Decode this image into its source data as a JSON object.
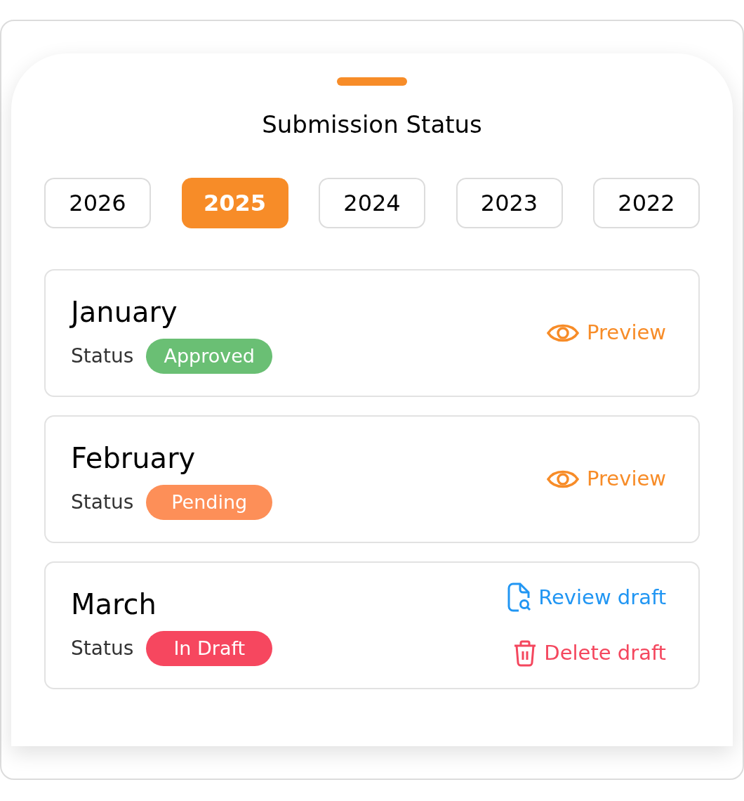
{
  "title": "Submission Status",
  "years": [
    {
      "label": "2026",
      "selected": false
    },
    {
      "label": "2025",
      "selected": true
    },
    {
      "label": "2024",
      "selected": false
    },
    {
      "label": "2023",
      "selected": false
    },
    {
      "label": "2022",
      "selected": false
    }
  ],
  "months": [
    {
      "month": "January",
      "status_label": "Status",
      "status": {
        "label": "Approved",
        "color": "#6abf74"
      },
      "actions": [
        {
          "kind": "preview",
          "label": "Preview"
        }
      ]
    },
    {
      "month": "February",
      "status_label": "Status",
      "status": {
        "label": "Pending",
        "color": "#fd8f58"
      },
      "actions": [
        {
          "kind": "preview",
          "label": "Preview"
        }
      ]
    },
    {
      "month": "March",
      "status_label": "Status",
      "status": {
        "label": "In Draft",
        "color": "#f6475f"
      },
      "actions": [
        {
          "kind": "review",
          "label": "Review draft"
        },
        {
          "kind": "delete",
          "label": "Delete draft"
        }
      ]
    }
  ]
}
